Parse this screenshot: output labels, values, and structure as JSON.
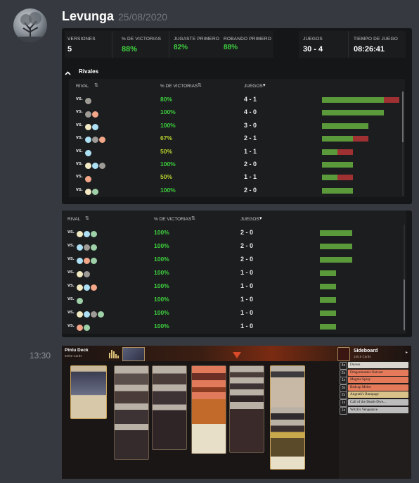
{
  "message": {
    "username": "Levunga",
    "timestamp": "25/08/2020",
    "avatar_icon": "tree-avatar-icon",
    "second_time": "13:30"
  },
  "stats": {
    "versions_label": "VERSIONES",
    "versions_value": "5",
    "win_pct_label": "% DE VICTORIAS",
    "win_pct_value": "88%",
    "play_first_label": "JUGASTE PRIMERO",
    "play_first_value": "82%",
    "draw_first_label": "ROBANDO PRIMERO",
    "draw_first_value": "88%",
    "games_label": "JUEGOS",
    "games_value": "30 - 4",
    "time_label": "TIEMPO DE JUEGO",
    "time_value": "08:26:41"
  },
  "rivals_title": "Rivales",
  "table_headers": {
    "rival": "RIVAL",
    "win_pct": "% DE VICTORIAS",
    "games": "JUEGOS"
  },
  "colors": {
    "green_text": "#3dd13d",
    "yellow_text": "#b7d12c",
    "win_bar": "#5a9a3b",
    "loss_bar": "#a03133"
  },
  "table1": [
    {
      "vs": "vs.",
      "mana": [
        "b"
      ],
      "pct": "80%",
      "games": "4 - 1",
      "win_frac": 0.8
    },
    {
      "vs": "vs.",
      "mana": [
        "b",
        "r"
      ],
      "pct": "100%",
      "games": "4 - 0",
      "win_frac": 1.0
    },
    {
      "vs": "vs.",
      "mana": [
        "w",
        "u"
      ],
      "pct": "100%",
      "games": "3 - 0",
      "win_frac": 1.0
    },
    {
      "vs": "vs.",
      "mana": [
        "u",
        "b",
        "r"
      ],
      "pct": "67%",
      "games": "2 - 1",
      "win_frac": 0.67
    },
    {
      "vs": "vs.",
      "mana": [
        "u"
      ],
      "pct": "50%",
      "games": "1 - 1",
      "win_frac": 0.5
    },
    {
      "vs": "vs.",
      "mana": [
        "w",
        "u",
        "b"
      ],
      "pct": "100%",
      "games": "2 - 0",
      "win_frac": 1.0
    },
    {
      "vs": "vs.",
      "mana": [
        "r"
      ],
      "pct": "50%",
      "games": "1 - 1",
      "win_frac": 0.5
    },
    {
      "vs": "vs.",
      "mana": [
        "w",
        "g"
      ],
      "pct": "100%",
      "games": "2 - 0",
      "win_frac": 1.0
    }
  ],
  "table2": [
    {
      "vs": "vs.",
      "mana": [
        "w",
        "u",
        "g"
      ],
      "pct": "100%",
      "games": "2 - 0",
      "win_frac": 1.0
    },
    {
      "vs": "vs.",
      "mana": [
        "u",
        "b",
        "g"
      ],
      "pct": "100%",
      "games": "2 - 0",
      "win_frac": 1.0
    },
    {
      "vs": "vs.",
      "mana": [
        "u",
        "r",
        "g"
      ],
      "pct": "100%",
      "games": "2 - 0",
      "win_frac": 1.0
    },
    {
      "vs": "vs.",
      "mana": [
        "w",
        "b"
      ],
      "pct": "100%",
      "games": "1 - 0",
      "win_frac": 1.0
    },
    {
      "vs": "vs.",
      "mana": [
        "w",
        "u",
        "r"
      ],
      "pct": "100%",
      "games": "1 - 0",
      "win_frac": 1.0
    },
    {
      "vs": "vs.",
      "mana": [
        "g"
      ],
      "pct": "100%",
      "games": "1 - 0",
      "win_frac": 1.0
    },
    {
      "vs": "vs.",
      "mana": [
        "w",
        "u",
        "b",
        "g"
      ],
      "pct": "100%",
      "games": "1 - 0",
      "win_frac": 1.0
    },
    {
      "vs": "vs.",
      "mana": [
        "r",
        "g"
      ],
      "pct": "100%",
      "games": "1 - 0",
      "win_frac": 1.0
    }
  ],
  "deck": {
    "name": "Pintu Deck",
    "count": "60/60 Cards",
    "sideboard_title": "Sideboard",
    "sideboard_count": "15/15 Cards",
    "sideboard": [
      {
        "qty": "4x",
        "name": "Duress",
        "color": "white"
      },
      {
        "qty": "2x",
        "name": "Dragonmaster Outcast",
        "color": "red"
      },
      {
        "qty": "1x",
        "name": "Magma Spray",
        "color": "red"
      },
      {
        "qty": "3x",
        "name": "Redcap Melee",
        "color": "red"
      },
      {
        "qty": "2x",
        "name": "Angrath's Rampage",
        "color": "gold"
      },
      {
        "qty": "1x",
        "name": "Call of the Death-Dwe...",
        "color": "grey"
      },
      {
        "qty": "1x",
        "name": "Witch's Vengeance",
        "color": "grey"
      }
    ]
  }
}
